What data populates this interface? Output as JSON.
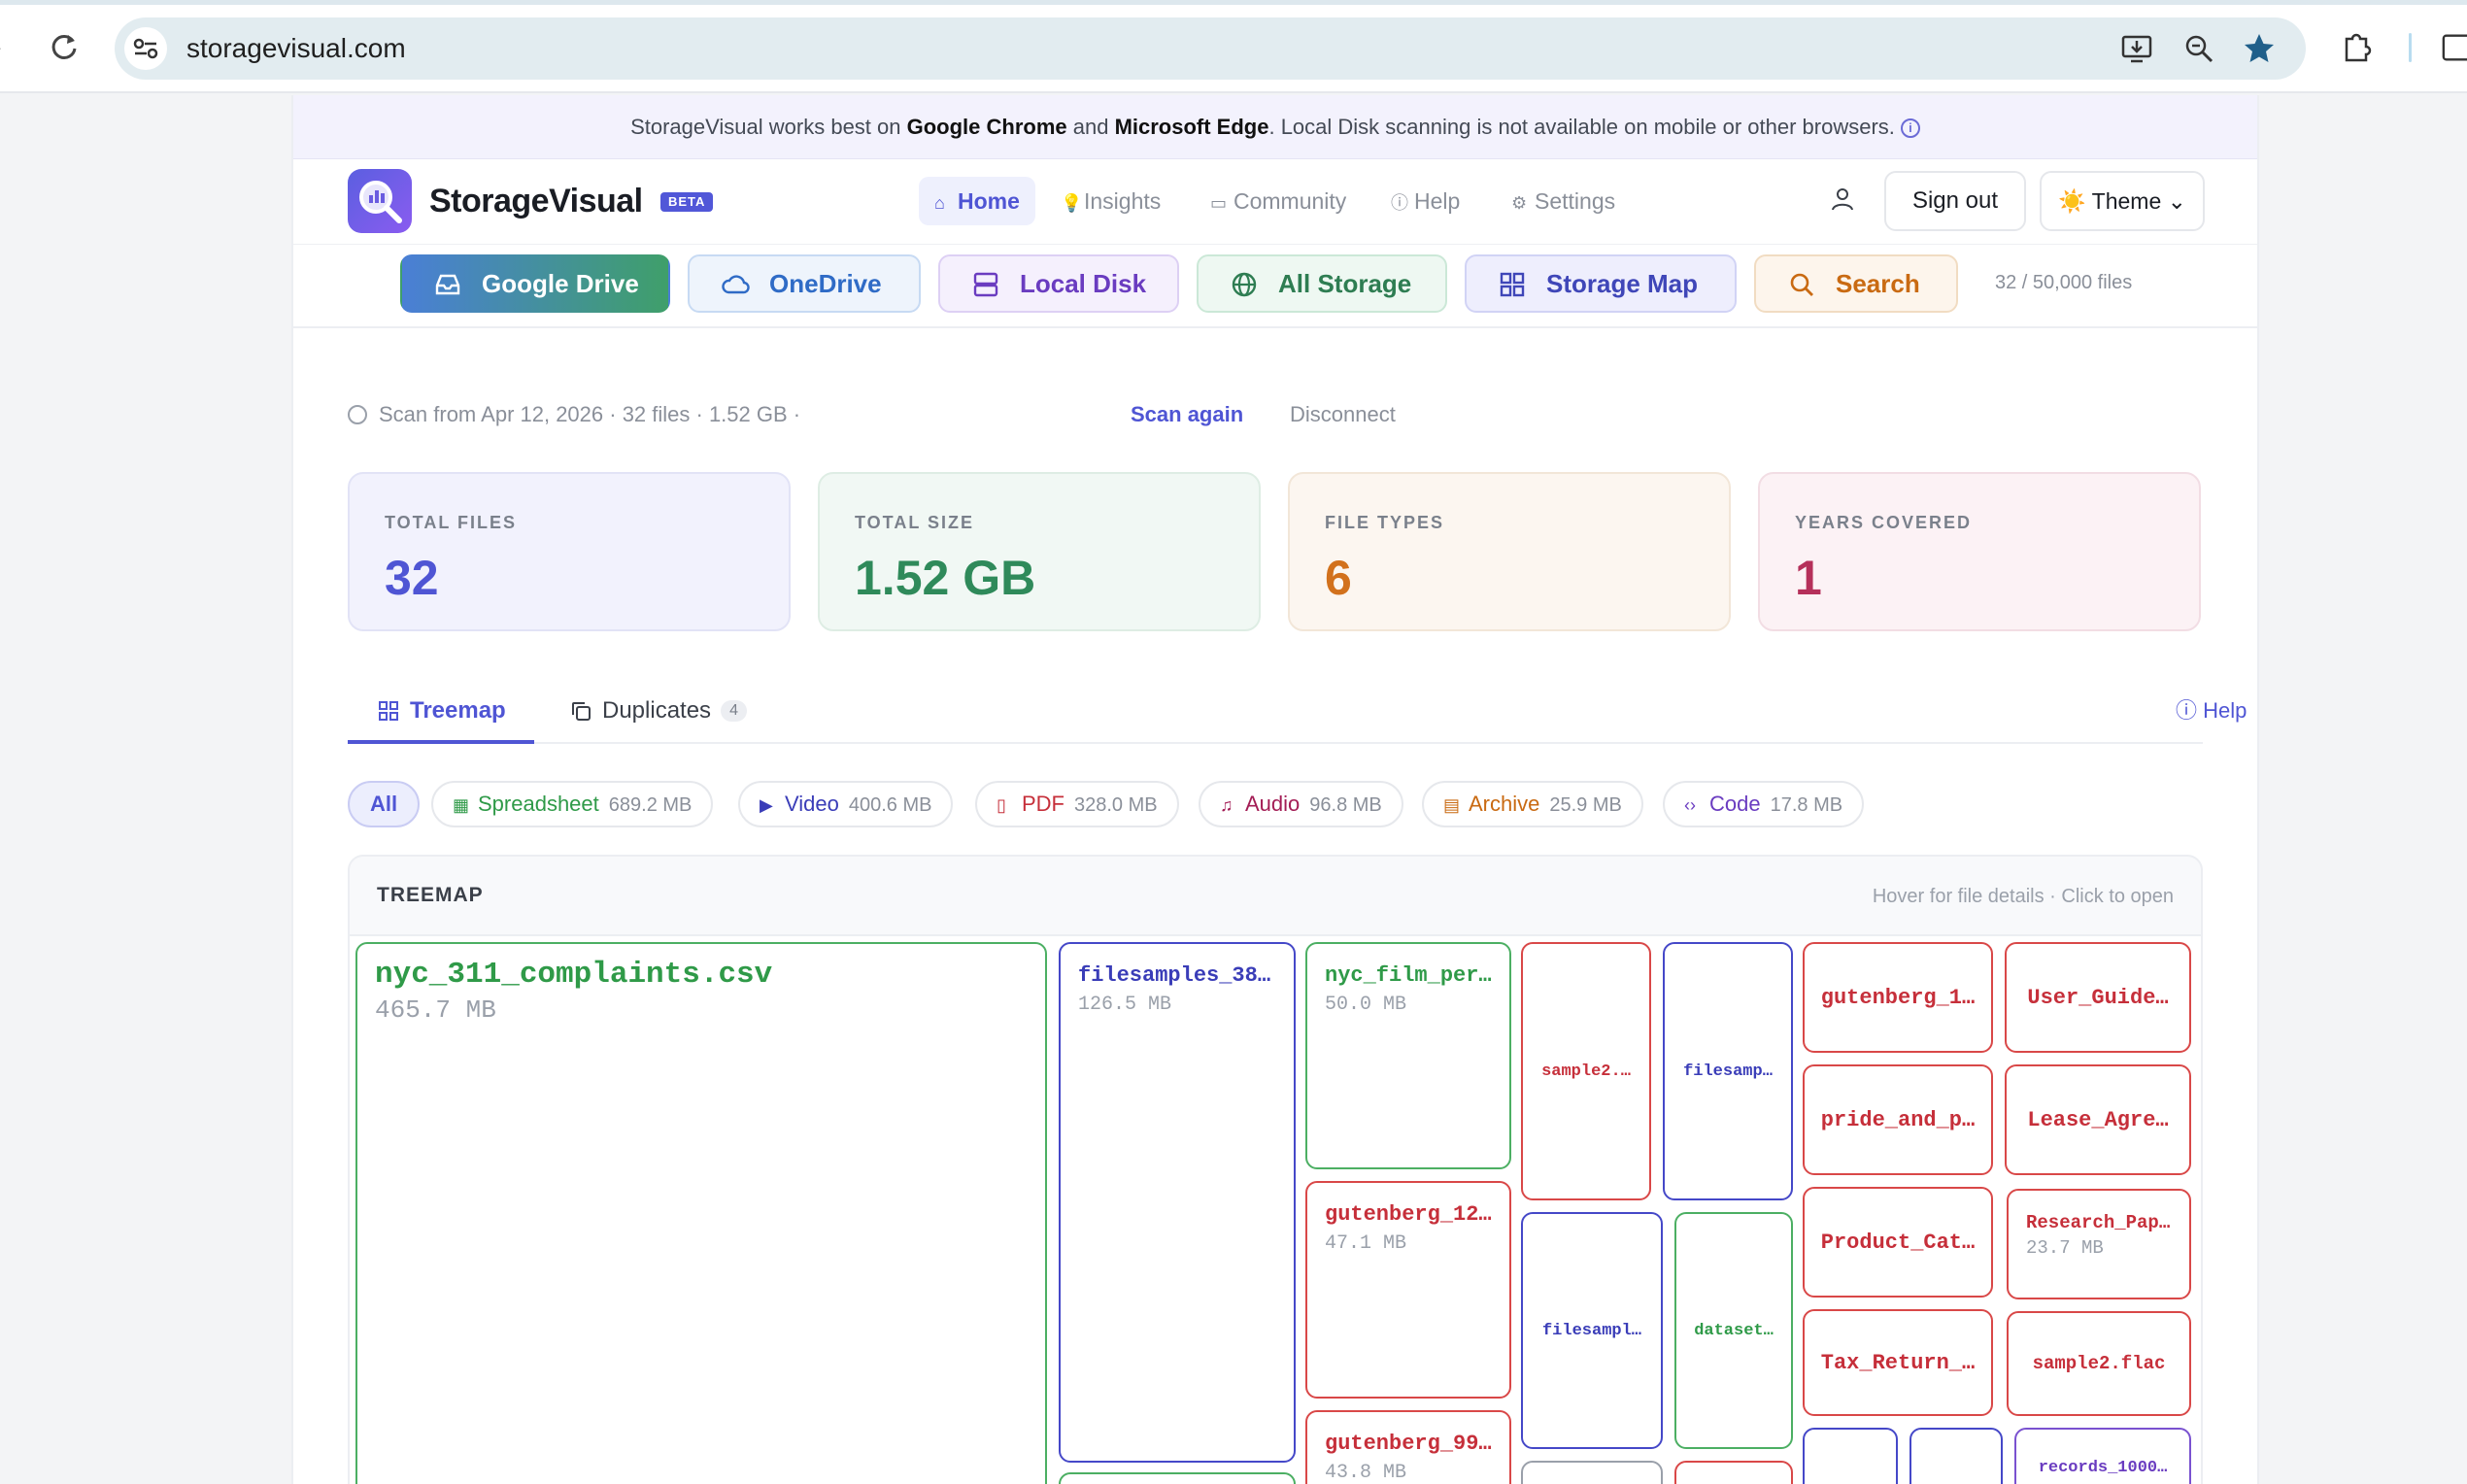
{
  "browser": {
    "url": "storagevisual.com"
  },
  "banner": {
    "prefix": "StorageVisual works best on ",
    "browser1": "Google Chrome",
    "and": " and ",
    "browser2": "Microsoft Edge",
    "suffix": ". Local Disk scanning is not available on mobile or other browsers."
  },
  "header": {
    "brand": "StorageVisual",
    "badge": "BETA",
    "nav": [
      {
        "label": "Home",
        "icon": "home-icon"
      },
      {
        "label": "Insights",
        "icon": "bulb-icon"
      },
      {
        "label": "Community",
        "icon": "chat-icon"
      },
      {
        "label": "Help",
        "icon": "help-icon"
      },
      {
        "label": "Settings",
        "icon": "gear-icon"
      }
    ],
    "sign_out": "Sign out",
    "theme": "Theme"
  },
  "sources": {
    "items": [
      "Google Drive",
      "OneDrive",
      "Local Disk",
      "All Storage",
      "Storage Map",
      "Search"
    ],
    "file_count": "32 / 50,000 files"
  },
  "scan": {
    "text": "Scan from Apr 12, 2026 · 32 files · 1.52 GB ·",
    "scan_again": "Scan again",
    "disconnect": "Disconnect"
  },
  "stats": [
    {
      "label": "TOTAL FILES",
      "value": "32"
    },
    {
      "label": "TOTAL SIZE",
      "value": "1.52 GB"
    },
    {
      "label": "FILE TYPES",
      "value": "6"
    },
    {
      "label": "YEARS COVERED",
      "value": "1"
    }
  ],
  "tabs": {
    "treemap": "Treemap",
    "duplicates": "Duplicates",
    "duplicates_count": "4",
    "help": "Help"
  },
  "filters": {
    "all": "All",
    "chips": [
      {
        "label": "Spreadsheet",
        "size": "689.2 MB",
        "color": "#2f9a48"
      },
      {
        "label": "Video",
        "size": "400.6 MB",
        "color": "#3a3db8"
      },
      {
        "label": "PDF",
        "size": "328.0 MB",
        "color": "#c62f3a"
      },
      {
        "label": "Audio",
        "size": "96.8 MB",
        "color": "#a31d55"
      },
      {
        "label": "Archive",
        "size": "25.9 MB",
        "color": "#c96a12"
      },
      {
        "label": "Code",
        "size": "17.8 MB",
        "color": "#6a3cc0"
      }
    ]
  },
  "treemap": {
    "title": "TREEMAP",
    "hint": "Hover for file details · Click to open",
    "cells": [
      {
        "name": "nyc_311_complaints.csv",
        "size": "465.7 MB"
      },
      {
        "name": "filesamples_38…",
        "size": "126.5 MB"
      },
      {
        "name": "nyc_film_per…",
        "size": "50.0 MB"
      },
      {
        "name": "gutenberg_12…",
        "size": "47.1 MB"
      },
      {
        "name": "gutenberg_99…",
        "size": "43.8 MB"
      },
      {
        "name": "sample2.…"
      },
      {
        "name": "filesamp…"
      },
      {
        "name": "filesampl…"
      },
      {
        "name": "dataset…"
      },
      {
        "name": "gutenberg_1…"
      },
      {
        "name": "User_Guide…"
      },
      {
        "name": "pride_and_p…"
      },
      {
        "name": "Lease_Agre…"
      },
      {
        "name": "Product_Cat…"
      },
      {
        "name": "Research_Pap…",
        "size": "23.7 MB"
      },
      {
        "name": "Tax_Return_…"
      },
      {
        "name": "sample2.flac"
      },
      {
        "name": "records_1000…"
      }
    ]
  }
}
